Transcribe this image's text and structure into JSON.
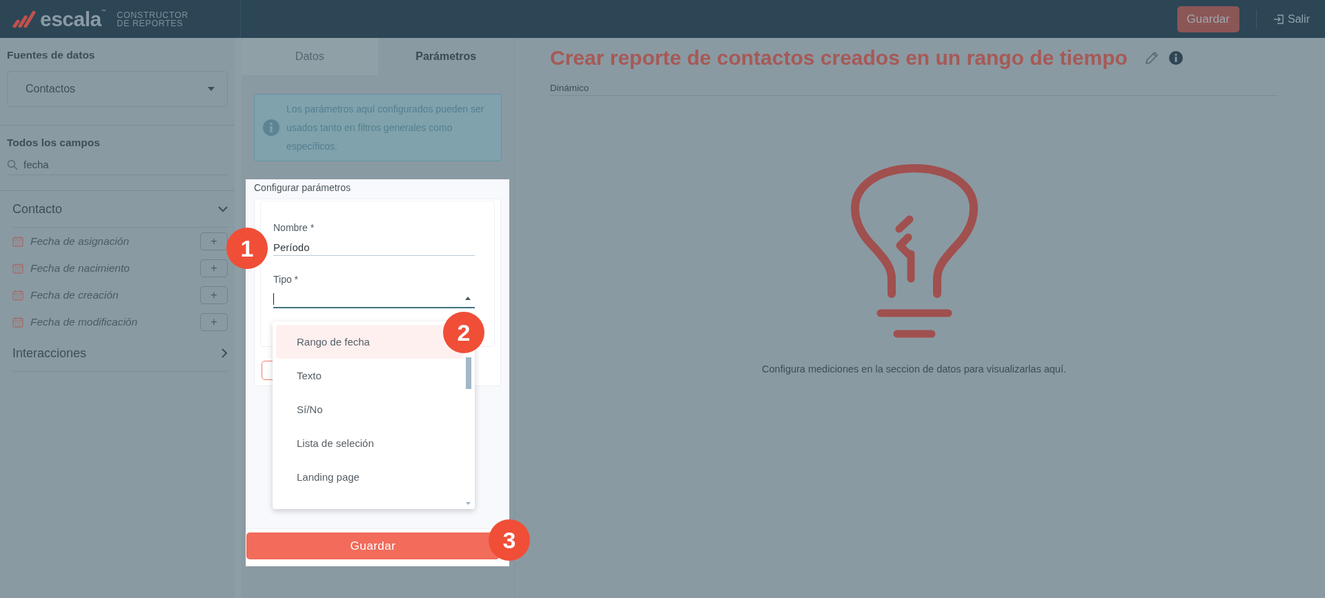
{
  "header": {
    "logo_text": "escala",
    "logo_mark": "™",
    "subtitle": "CONSTRUCTOR DE REPORTES",
    "save_button": "Guardar",
    "exit_link": "Salir"
  },
  "sidebar": {
    "sources_title": "Fuentes de datos",
    "source_select": "Contactos",
    "fields_title": "Todos los campos",
    "search_value": "fecha",
    "groups": [
      {
        "label": "Contacto",
        "expanded": true,
        "items": [
          {
            "label": "Fecha de asignación",
            "add": "+"
          },
          {
            "label": "Fecha de nacimiento",
            "add": "+"
          },
          {
            "label": "Fecha de creación",
            "add": "+"
          },
          {
            "label": "Fecha de modificación",
            "add": "+"
          }
        ]
      },
      {
        "label": "Interacciones",
        "expanded": false
      }
    ]
  },
  "panel": {
    "tabs": [
      {
        "label": "Datos",
        "selected": false
      },
      {
        "label": "Parámetros",
        "selected": true
      }
    ],
    "info": "Los parámetros aquí configurados pueden ser usados tanto en filtros generales como específicos.",
    "section_title": "Configurar parámetros",
    "fields": [
      {
        "label": "Nombre *",
        "value": "Período",
        "focused": false,
        "callout": "1"
      },
      {
        "label": "Tipo *",
        "focused": true
      }
    ],
    "dropdown": {
      "callout": "2",
      "options": [
        {
          "label": "Rango de fecha",
          "selected": true
        },
        {
          "label": "Texto",
          "selected": false
        },
        {
          "label": "Sí/No",
          "selected": false
        },
        {
          "label": "Lista de seleción",
          "selected": false
        },
        {
          "label": "Landing page",
          "selected": false
        }
      ]
    },
    "save_button": {
      "label": "Guardar",
      "callout": "3"
    }
  },
  "main": {
    "title": "Crear reporte de contactos creados en un rango de tiempo",
    "mode_label": "Dinámico",
    "empty_message": "Configura mediciones en la seccion de datos para visualizarlas aquí."
  }
}
